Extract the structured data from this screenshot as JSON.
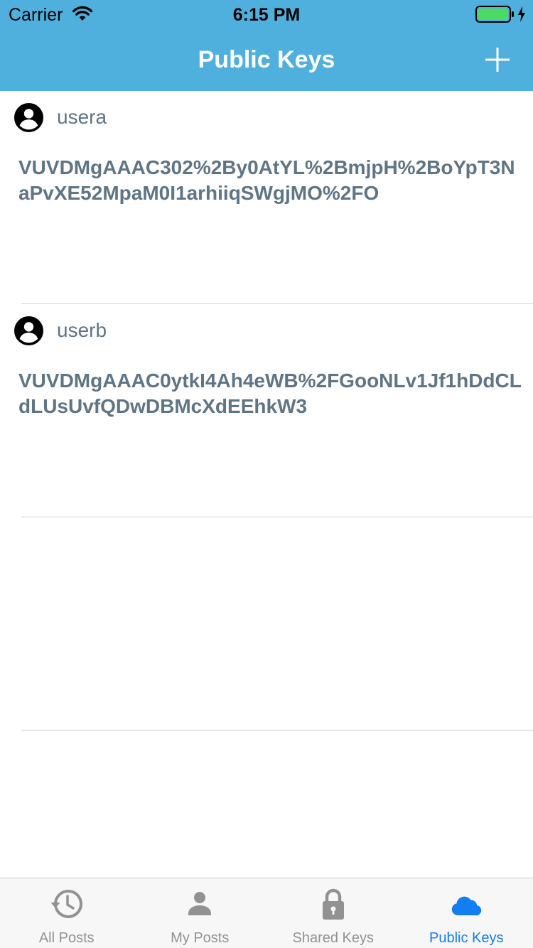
{
  "colors": {
    "nav_bg": "#4fb0de",
    "text_muted": "#5f7585",
    "tab_inactive": "#929292",
    "tab_active": "#137ef2",
    "battery_fill": "#4cd964"
  },
  "status_bar": {
    "carrier": "Carrier",
    "time": "6:15 PM"
  },
  "nav": {
    "title": "Public Keys",
    "add_icon": "plus-icon"
  },
  "keys": [
    {
      "user": "usera",
      "key": "VUVDMgAAAC302%2By0AtYL%2BmjpH%2BoYpT3NaPvXE52MpaM0I1arhiiqSWgjMO%2FO"
    },
    {
      "user": "userb",
      "key": "VUVDMgAAAC0ytkI4Ah4eWB%2FGooNLv1Jf1hDdCLdLUsUvfQDwDBMcXdEEhkW3"
    }
  ],
  "tabs": [
    {
      "label": "All Posts",
      "icon": "history-icon",
      "active": false
    },
    {
      "label": "My Posts",
      "icon": "person-icon",
      "active": false
    },
    {
      "label": "Shared Keys",
      "icon": "lock-icon",
      "active": false
    },
    {
      "label": "Public Keys",
      "icon": "cloud-icon",
      "active": true
    }
  ]
}
